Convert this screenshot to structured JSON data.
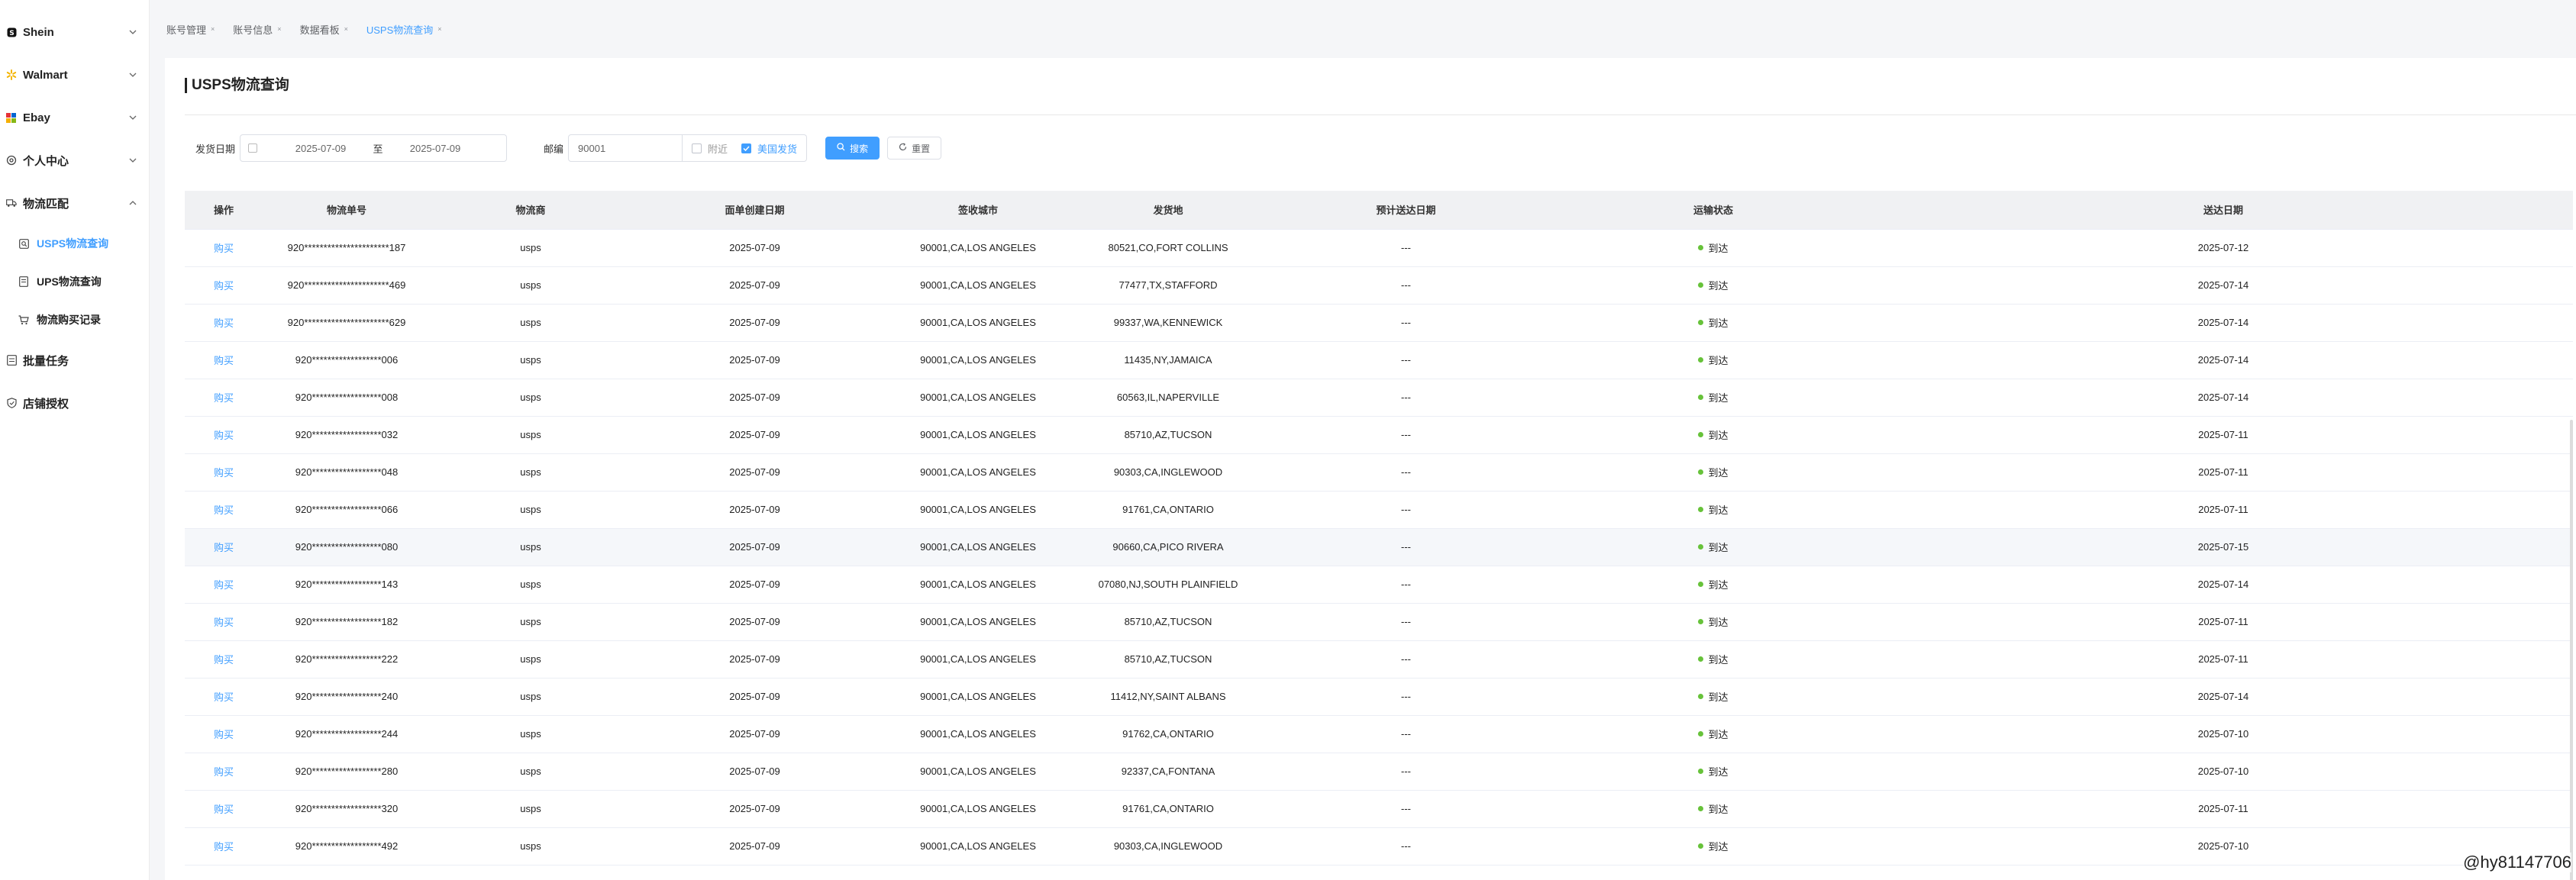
{
  "sidebar": {
    "groups": [
      {
        "label": "Shein"
      },
      {
        "label": "Walmart"
      },
      {
        "label": "Ebay"
      },
      {
        "label": "个人中心"
      },
      {
        "label": "物流匹配"
      }
    ],
    "subitems": [
      {
        "label": "USPS物流查询"
      },
      {
        "label": "UPS物流查询"
      },
      {
        "label": "物流购买记录"
      }
    ],
    "bottom": [
      {
        "label": "批量任务"
      },
      {
        "label": "店铺授权"
      }
    ]
  },
  "breadcrumb": [
    "账号管理",
    "账号信息",
    "数据看板",
    "USPS物流查询"
  ],
  "page": {
    "title": "USPS物流查询"
  },
  "filters": {
    "ship_date_label": "发货日期",
    "date_start": "2025-07-09",
    "date_sep": "至",
    "date_end": "2025-07-09",
    "zip_label": "邮编",
    "zip_value": "90001",
    "nearby_label": "附近",
    "us_ship_label": "美国发货",
    "search_label": "搜索",
    "reset_label": "重置"
  },
  "table": {
    "headers": [
      "操作",
      "物流单号",
      "物流商",
      "面单创建日期",
      "签收城市",
      "发货地",
      "预计送达日期",
      "运输状态",
      "送达日期"
    ],
    "action_label": "购买",
    "rows": [
      {
        "no": "920**********************187",
        "carrier": "usps",
        "created": "2025-07-09",
        "city": "90001,CA,LOS ANGELES",
        "origin": "80521,CO,FORT COLLINS",
        "eta": "---",
        "status": "到达",
        "delivered": "2025-07-12"
      },
      {
        "no": "920**********************469",
        "carrier": "usps",
        "created": "2025-07-09",
        "city": "90001,CA,LOS ANGELES",
        "origin": "77477,TX,STAFFORD",
        "eta": "---",
        "status": "到达",
        "delivered": "2025-07-14"
      },
      {
        "no": "920**********************629",
        "carrier": "usps",
        "created": "2025-07-09",
        "city": "90001,CA,LOS ANGELES",
        "origin": "99337,WA,KENNEWICK",
        "eta": "---",
        "status": "到达",
        "delivered": "2025-07-14"
      },
      {
        "no": "920******************006",
        "carrier": "usps",
        "created": "2025-07-09",
        "city": "90001,CA,LOS ANGELES",
        "origin": "11435,NY,JAMAICA",
        "eta": "---",
        "status": "到达",
        "delivered": "2025-07-14"
      },
      {
        "no": "920******************008",
        "carrier": "usps",
        "created": "2025-07-09",
        "city": "90001,CA,LOS ANGELES",
        "origin": "60563,IL,NAPERVILLE",
        "eta": "---",
        "status": "到达",
        "delivered": "2025-07-14"
      },
      {
        "no": "920******************032",
        "carrier": "usps",
        "created": "2025-07-09",
        "city": "90001,CA,LOS ANGELES",
        "origin": "85710,AZ,TUCSON",
        "eta": "---",
        "status": "到达",
        "delivered": "2025-07-11"
      },
      {
        "no": "920******************048",
        "carrier": "usps",
        "created": "2025-07-09",
        "city": "90001,CA,LOS ANGELES",
        "origin": "90303,CA,INGLEWOOD",
        "eta": "---",
        "status": "到达",
        "delivered": "2025-07-11"
      },
      {
        "no": "920******************066",
        "carrier": "usps",
        "created": "2025-07-09",
        "city": "90001,CA,LOS ANGELES",
        "origin": "91761,CA,ONTARIO",
        "eta": "---",
        "status": "到达",
        "delivered": "2025-07-11"
      },
      {
        "no": "920******************080",
        "carrier": "usps",
        "created": "2025-07-09",
        "city": "90001,CA,LOS ANGELES",
        "origin": "90660,CA,PICO RIVERA",
        "eta": "---",
        "status": "到达",
        "delivered": "2025-07-15"
      },
      {
        "no": "920******************143",
        "carrier": "usps",
        "created": "2025-07-09",
        "city": "90001,CA,LOS ANGELES",
        "origin": "07080,NJ,SOUTH PLAINFIELD",
        "eta": "---",
        "status": "到达",
        "delivered": "2025-07-14"
      },
      {
        "no": "920******************182",
        "carrier": "usps",
        "created": "2025-07-09",
        "city": "90001,CA,LOS ANGELES",
        "origin": "85710,AZ,TUCSON",
        "eta": "---",
        "status": "到达",
        "delivered": "2025-07-11"
      },
      {
        "no": "920******************222",
        "carrier": "usps",
        "created": "2025-07-09",
        "city": "90001,CA,LOS ANGELES",
        "origin": "85710,AZ,TUCSON",
        "eta": "---",
        "status": "到达",
        "delivered": "2025-07-11"
      },
      {
        "no": "920******************240",
        "carrier": "usps",
        "created": "2025-07-09",
        "city": "90001,CA,LOS ANGELES",
        "origin": "11412,NY,SAINT ALBANS",
        "eta": "---",
        "status": "到达",
        "delivered": "2025-07-14"
      },
      {
        "no": "920******************244",
        "carrier": "usps",
        "created": "2025-07-09",
        "city": "90001,CA,LOS ANGELES",
        "origin": "91762,CA,ONTARIO",
        "eta": "---",
        "status": "到达",
        "delivered": "2025-07-10"
      },
      {
        "no": "920******************280",
        "carrier": "usps",
        "created": "2025-07-09",
        "city": "90001,CA,LOS ANGELES",
        "origin": "92337,CA,FONTANA",
        "eta": "---",
        "status": "到达",
        "delivered": "2025-07-10"
      },
      {
        "no": "920******************320",
        "carrier": "usps",
        "created": "2025-07-09",
        "city": "90001,CA,LOS ANGELES",
        "origin": "91761,CA,ONTARIO",
        "eta": "---",
        "status": "到达",
        "delivered": "2025-07-11"
      },
      {
        "no": "920******************492",
        "carrier": "usps",
        "created": "2025-07-09",
        "city": "90001,CA,LOS ANGELES",
        "origin": "90303,CA,INGLEWOOD",
        "eta": "---",
        "status": "到达",
        "delivered": "2025-07-10"
      }
    ]
  },
  "watermark": "@hy81147706",
  "colors": {
    "accent": "#409eff",
    "status_ok": "#67c23a"
  }
}
